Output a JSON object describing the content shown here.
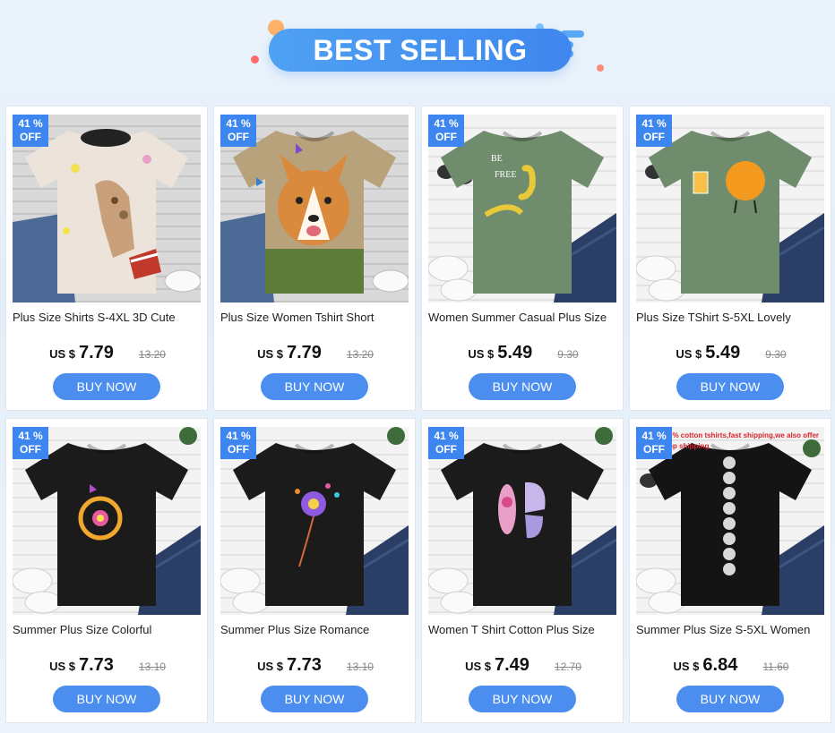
{
  "header": {
    "title": "BEST SELLING",
    "accent": "#3f86ee"
  },
  "products": [
    {
      "title": "Plus Size Shirts S-4XL 3D Cute",
      "discount_top": "41 %",
      "discount_bottom": "OFF",
      "currency": "US $",
      "price": "7.79",
      "old_price": "13.20",
      "button": "BUY NOW",
      "image": "giraffe-print-tshirt"
    },
    {
      "title": "Plus Size Women Tshirt Short",
      "discount_top": "41 %",
      "discount_bottom": "OFF",
      "currency": "US $",
      "price": "7.79",
      "old_price": "13.20",
      "button": "BUY NOW",
      "image": "corgi-print-tshirt"
    },
    {
      "title": "Women Summer Casual Plus Size",
      "discount_top": "41 %",
      "discount_bottom": "OFF",
      "currency": "US $",
      "price": "5.49",
      "old_price": "9.30",
      "button": "BUY NOW",
      "image": "green-banana-tshirt"
    },
    {
      "title": "Plus Size TShirt S-5XL Lovely",
      "discount_top": "41 %",
      "discount_bottom": "OFF",
      "currency": "US $",
      "price": "5.49",
      "old_price": "9.30",
      "button": "BUY NOW",
      "image": "green-orange-tshirt"
    },
    {
      "title": "Summer Plus Size Colorful",
      "discount_top": "41 %",
      "discount_bottom": "OFF",
      "currency": "US $",
      "price": "7.73",
      "old_price": "13.10",
      "button": "BUY NOW",
      "image": "black-flower-wreath-tshirt"
    },
    {
      "title": "Summer Plus Size Romance",
      "discount_top": "41 %",
      "discount_bottom": "OFF",
      "currency": "US $",
      "price": "7.73",
      "old_price": "13.10",
      "button": "BUY NOW",
      "image": "black-dandelion-tshirt"
    },
    {
      "title": "Women T Shirt Cotton Plus Size",
      "discount_top": "41 %",
      "discount_bottom": "OFF",
      "currency": "US $",
      "price": "7.49",
      "old_price": "12.70",
      "button": "BUY NOW",
      "image": "black-butterfly-tshirt"
    },
    {
      "title": "Summer Plus Size S-5XL Women",
      "discount_top": "41 %",
      "discount_bottom": "OFF",
      "currency": "US $",
      "price": "6.84",
      "old_price": "11.60",
      "button": "BUY NOW",
      "image": "black-moon-phase-tshirt",
      "image_caption_top": "0% cotton tshirts,fast shipping,we also offer",
      "image_caption_bottom": "op shipping"
    }
  ]
}
